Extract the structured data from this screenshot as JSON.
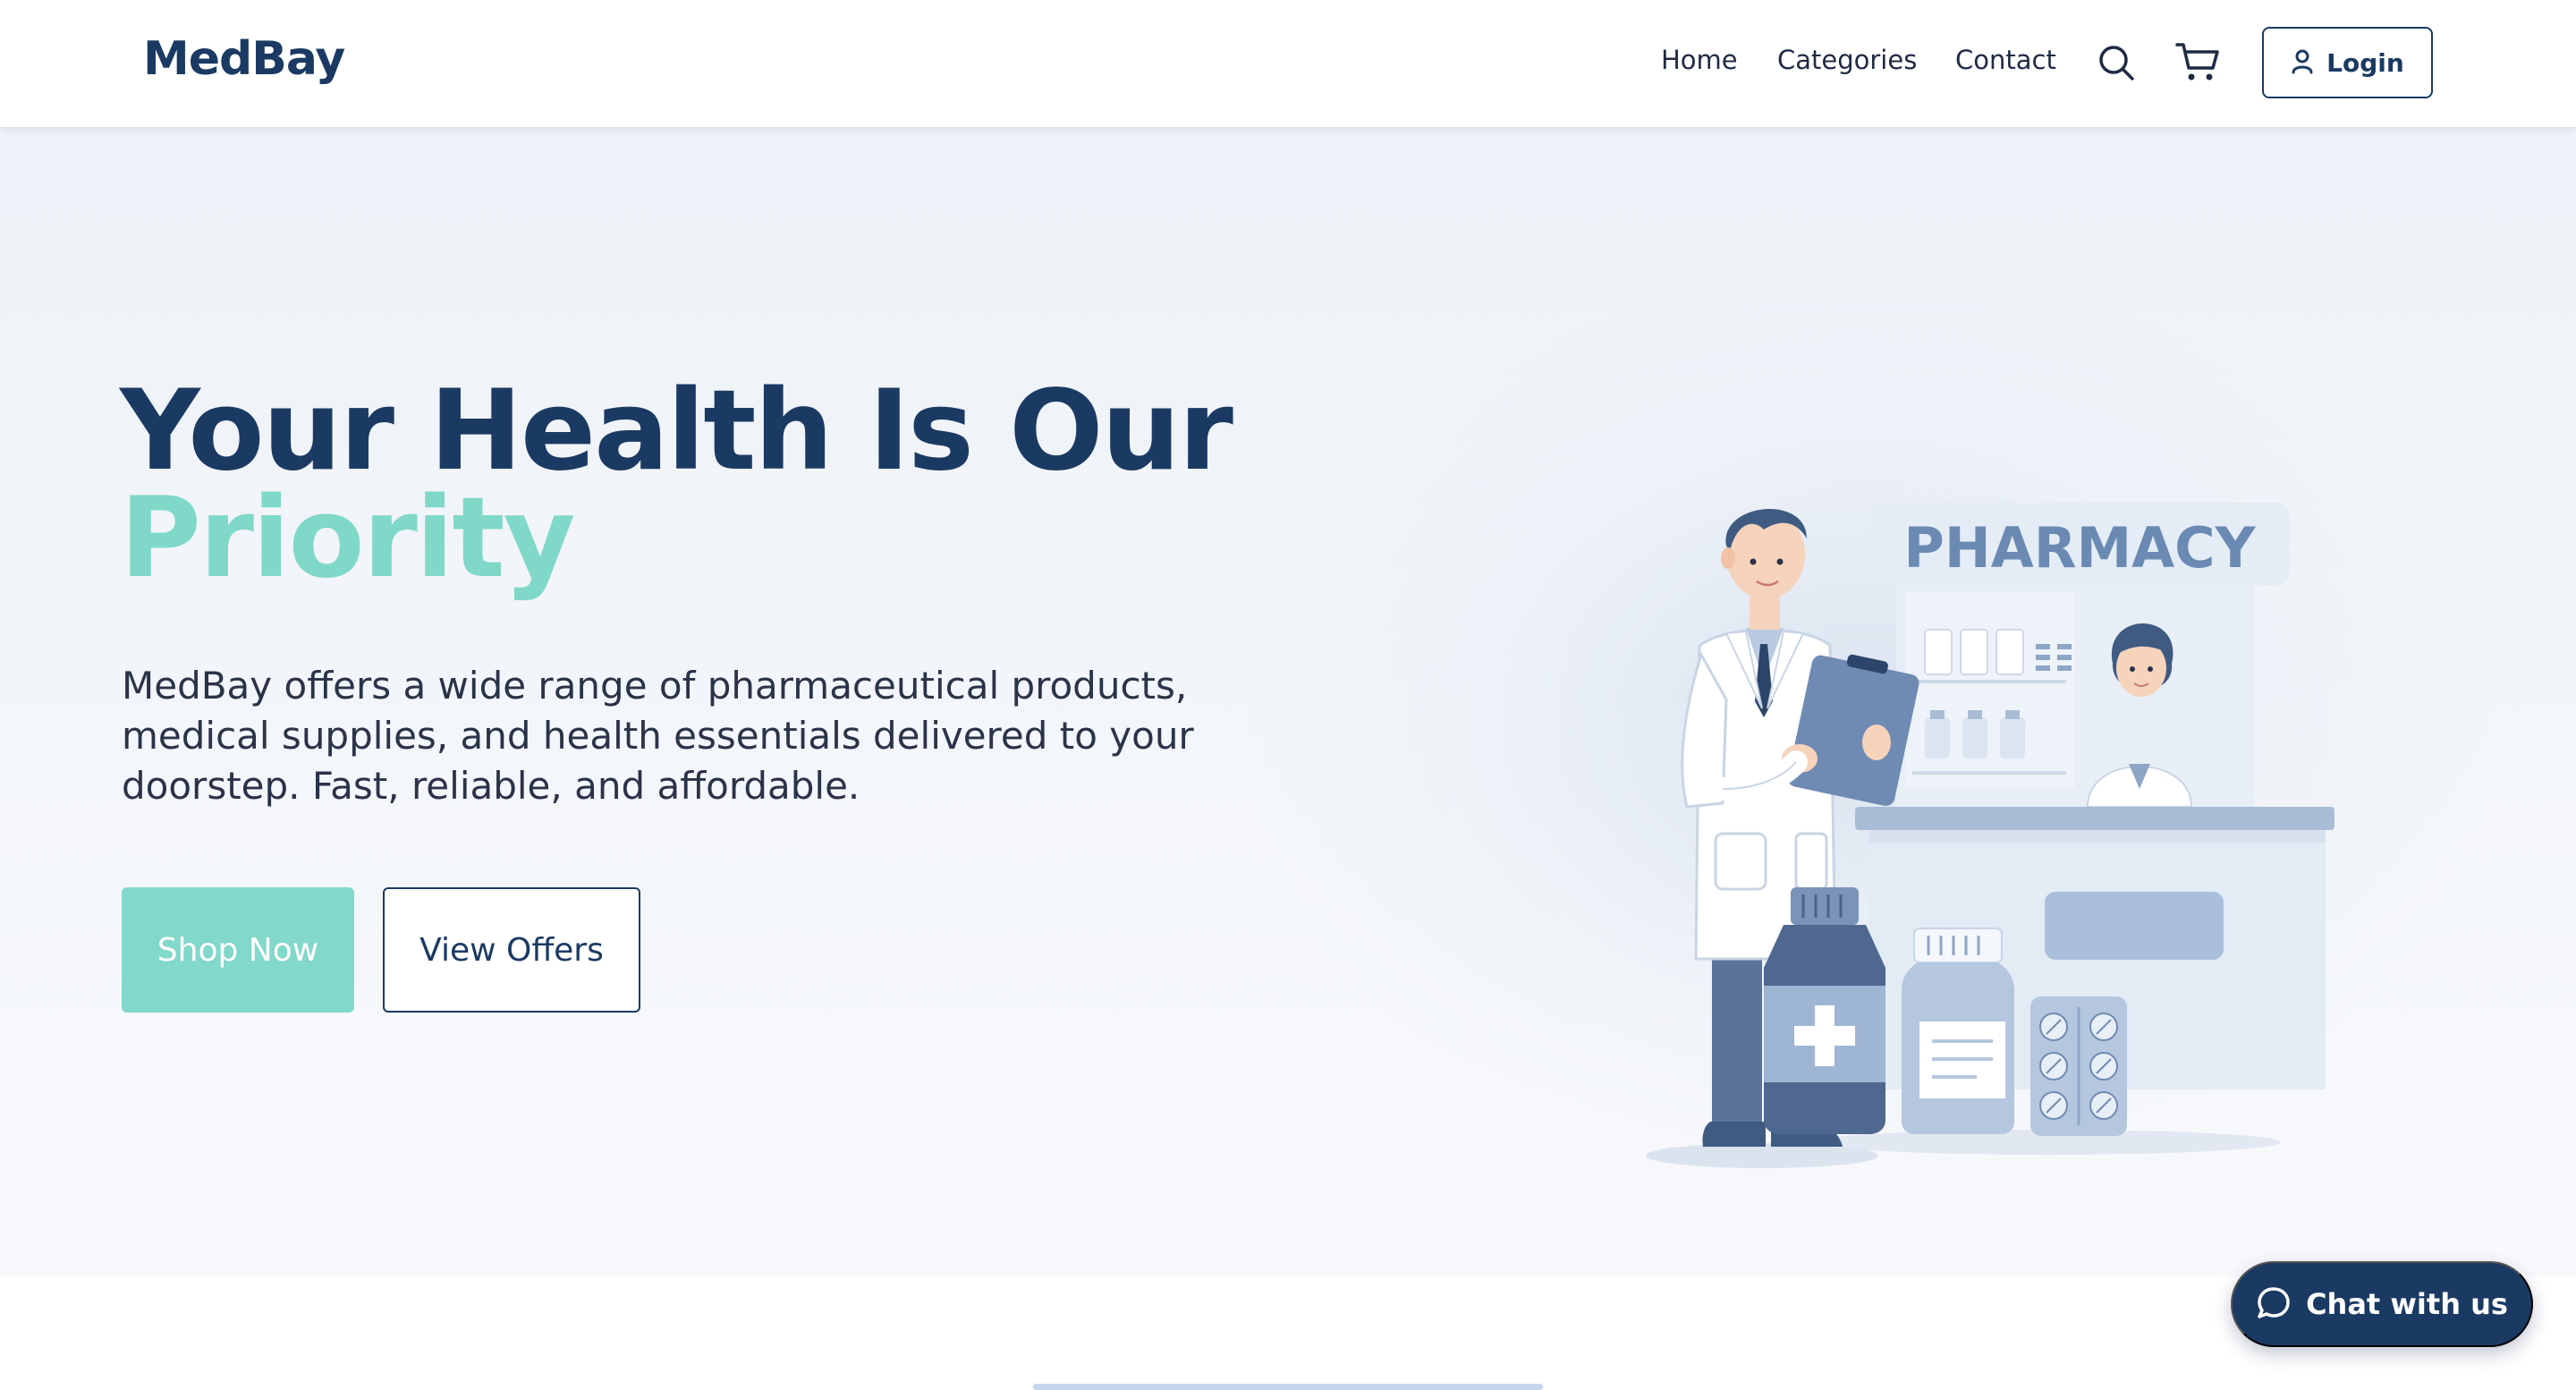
{
  "header": {
    "logo": "MedBay",
    "nav": [
      "Home",
      "Categories",
      "Contact"
    ],
    "search_icon": "search-icon",
    "cart_icon": "cart-icon",
    "login_label": "Login",
    "login_icon": "user-icon"
  },
  "hero": {
    "headline_line1": "Your Health Is Our",
    "headline_line2": "Priority",
    "description": "MedBay offers a wide range of pharmaceutical products, medical supplies, and health essentials delivered to your doorstep. Fast, reliable, and affordable.",
    "primary_cta": "Shop Now",
    "secondary_cta": "View Offers",
    "illustration": {
      "sign_text": "PHARMACY"
    }
  },
  "chat": {
    "label": "Chat with us",
    "icon": "chat-bubble-icon"
  },
  "colors": {
    "brand_navy": "#1b3a63",
    "accent_mint": "#7fd8c8",
    "hero_bg": "#eef2f8"
  }
}
